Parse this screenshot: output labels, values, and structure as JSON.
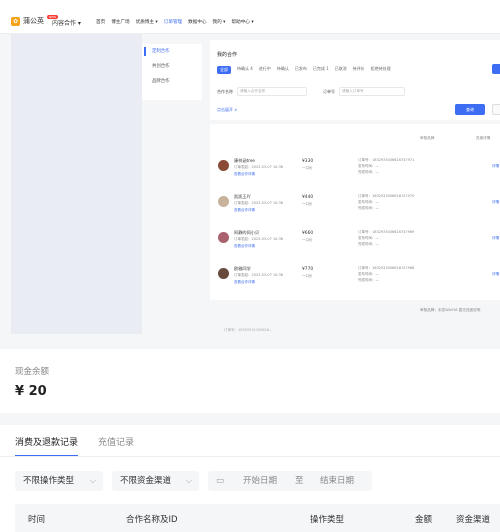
{
  "topbar": {
    "logo_text": "蒲公英",
    "new_badge": "NEW",
    "coop_label": "内容合作 ▾",
    "nav": [
      "首页",
      "博主广场",
      "优质博主 ▾",
      "订单管理",
      "数据中心",
      "我的 ▾",
      "帮助中心 ▾"
    ],
    "active_nav": 3
  },
  "side_menu": {
    "items": [
      "定制合作",
      "共创合作",
      "品牌合作"
    ],
    "active": 0
  },
  "orders_panel": {
    "title": "我的合作",
    "tabs": [
      "全部",
      "待确认 4",
      "进行中",
      "待确认",
      "已发布",
      "已完成 1",
      "已取消",
      "待评价",
      "拒绝待处理"
    ],
    "filter_label": "合作名称",
    "filter_placeholder": "请输入合作名称",
    "order_label": "订单号",
    "order_placeholder": "请输入订单号",
    "expand_label": "点击展开 ∨",
    "search_label": "查询"
  },
  "order_list": {
    "head_status": "审核品牌",
    "head_op": "进度详情",
    "rows": [
      {
        "name": "康梓涵tree",
        "desc": "订单发起：2023-03-07 10:36",
        "tag": "查看合作详情",
        "price": "¥330",
        "period": "一口价",
        "order_no": "订单号：1632933006616747971",
        "order_extra": "发布时间：—",
        "order_extra2": "完成时间：—",
        "op": "详情",
        "avatar_color": "#8a4b36"
      },
      {
        "name": "凯凯王吖",
        "desc": "订单发起：2023-03-07 10:36",
        "tag": "查看合作详情",
        "price": "¥440",
        "period": "一口价",
        "order_no": "订单号：1632933006616747970",
        "order_extra": "发布时间：—",
        "order_extra2": "完成时间：—",
        "op": "详情",
        "avatar_color": "#c9b29b"
      },
      {
        "name": "阿静的同小贝",
        "desc": "订单发起：2023-03-07 10:36",
        "tag": "查看合作详情",
        "price": "¥660",
        "period": "一口价",
        "order_no": "订单号：1632933006616747969",
        "order_extra": "发布时间：—",
        "order_extra2": "完成时间：—",
        "op": "详情",
        "avatar_color": "#a8616d"
      },
      {
        "name": "欧雅同学",
        "desc": "订单发起：2023-03-07 10:36",
        "tag": "查看合作详情",
        "price": "¥770",
        "period": "一口价",
        "order_no": "订单号：1632933006616747968",
        "order_extra": "发布时间：—",
        "order_extra2": "完成时间：—",
        "op": "详情",
        "avatar_color": "#6a4a3c"
      }
    ],
    "footer": "审核品牌：未发WASYA   暂无进度说明",
    "cut_row": "订单号：16329331106616..."
  },
  "balance": {
    "label": "现金余额",
    "value": "¥ 20"
  },
  "records": {
    "tabs": [
      "消费及退款记录",
      "充值记录"
    ],
    "active_tab": 0,
    "op_type": "不限操作类型",
    "channel": "不限资金渠道",
    "start_date": "开始日期",
    "to": "至",
    "end_date": "结束日期",
    "columns": [
      "时间",
      "合作名称及ID",
      "操作类型",
      "金额",
      "资金渠道"
    ]
  },
  "colors": {
    "accent": "#3d6df2",
    "brand": "#f7a21b"
  }
}
